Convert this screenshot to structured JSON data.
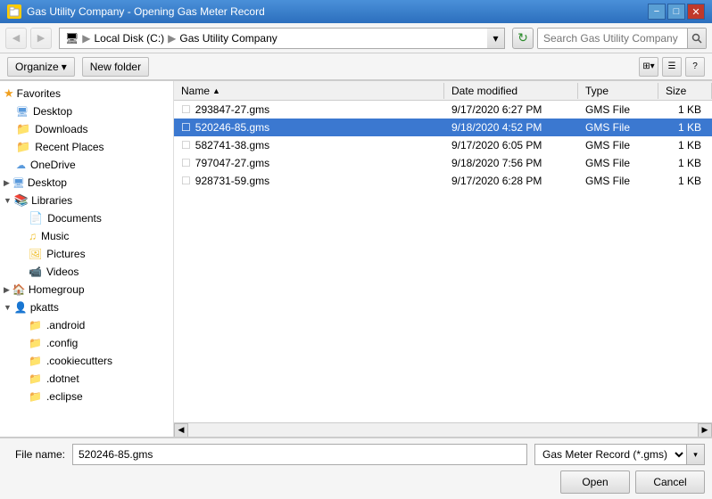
{
  "window": {
    "title": "Gas Utility Company - Opening Gas Meter Record",
    "icon": "folder-icon"
  },
  "titleButtons": {
    "minimize": "−",
    "maximize": "□",
    "close": "✕"
  },
  "addressBar": {
    "navBack": "◀",
    "navForward": "▶",
    "pathParts": [
      "Computer",
      "Local Disk (C:)",
      "Gas Utility Company"
    ],
    "refreshIcon": "↻",
    "searchPlaceholder": "Search Gas Utility Company",
    "searchIconLabel": "search"
  },
  "toolbar": {
    "organizeLabel": "Organize",
    "newFolderLabel": "New folder",
    "viewDropdown": "⊞",
    "viewToggle": "☰",
    "helpIcon": "?"
  },
  "sidebar": {
    "favoritesHeader": "Favorites",
    "items": [
      {
        "id": "desktop",
        "label": "Desktop",
        "indent": 1,
        "icon": "desktop"
      },
      {
        "id": "downloads",
        "label": "Downloads",
        "indent": 1,
        "icon": "folder-blue"
      },
      {
        "id": "recent",
        "label": "Recent Places",
        "indent": 1,
        "icon": "folder-blue"
      },
      {
        "id": "onedrive",
        "label": "OneDrive",
        "indent": 1,
        "icon": "cloud"
      }
    ],
    "desktopHeader": "Desktop",
    "librariesHeader": "Libraries",
    "libraryItems": [
      {
        "id": "documents",
        "label": "Documents",
        "indent": 2,
        "icon": "library"
      },
      {
        "id": "music",
        "label": "Music",
        "indent": 2,
        "icon": "music"
      },
      {
        "id": "pictures",
        "label": "Pictures",
        "indent": 2,
        "icon": "pictures"
      },
      {
        "id": "videos",
        "label": "Videos",
        "indent": 2,
        "icon": "video"
      }
    ],
    "homegroupHeader": "Homegroup",
    "pkattsHeader": "pkatts",
    "pkattsItems": [
      {
        "id": "android",
        "label": ".android",
        "indent": 2,
        "icon": "dotfolder"
      },
      {
        "id": "config",
        "label": ".config",
        "indent": 2,
        "icon": "dotfolder"
      },
      {
        "id": "cookiecutters",
        "label": ".cookiecutters",
        "indent": 2,
        "icon": "dotfolder"
      },
      {
        "id": "dotnet",
        "label": ".dotnet",
        "indent": 2,
        "icon": "dotfolder"
      },
      {
        "id": "eclipse",
        "label": ".eclipse",
        "indent": 2,
        "icon": "dotfolder"
      }
    ]
  },
  "fileList": {
    "columns": [
      {
        "id": "name",
        "label": "Name",
        "sortArrow": "▲"
      },
      {
        "id": "date",
        "label": "Date modified"
      },
      {
        "id": "type",
        "label": "Type"
      },
      {
        "id": "size",
        "label": "Size"
      }
    ],
    "files": [
      {
        "id": 1,
        "name": "293847-27.gms",
        "date": "9/17/2020 6:27 PM",
        "type": "GMS File",
        "size": "1 KB",
        "selected": false
      },
      {
        "id": 2,
        "name": "520246-85.gms",
        "date": "9/18/2020 4:52 PM",
        "type": "GMS File",
        "size": "1 KB",
        "selected": true
      },
      {
        "id": 3,
        "name": "582741-38.gms",
        "date": "9/17/2020 6:05 PM",
        "type": "GMS File",
        "size": "1 KB",
        "selected": false
      },
      {
        "id": 4,
        "name": "797047-27.gms",
        "date": "9/18/2020 7:56 PM",
        "type": "GMS File",
        "size": "1 KB",
        "selected": false
      },
      {
        "id": 5,
        "name": "928731-59.gms",
        "date": "9/17/2020 6:28 PM",
        "type": "GMS File",
        "size": "1 KB",
        "selected": false
      }
    ]
  },
  "bottomBar": {
    "fileNameLabel": "File name:",
    "fileNameValue": "520246-85.gms",
    "fileTypePlaceholder": "Gas Meter Record (*.gms)",
    "openButton": "Open",
    "cancelButton": "Cancel"
  }
}
